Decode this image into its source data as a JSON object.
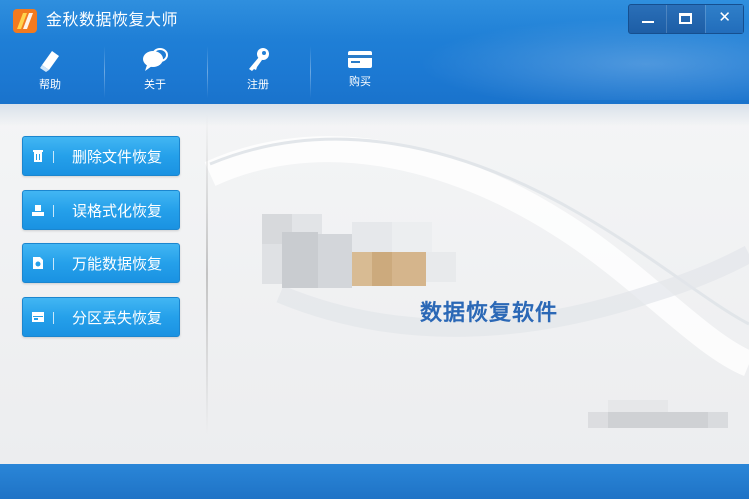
{
  "window": {
    "title": "金秋数据恢复大师",
    "controls": {
      "minimize": "–",
      "maximize": "□",
      "close": "✕"
    }
  },
  "toolbar": {
    "items": [
      {
        "label": "帮助",
        "icon": "eraser-icon"
      },
      {
        "label": "关于",
        "icon": "chat-bubble-icon"
      },
      {
        "label": "注册",
        "icon": "key-icon"
      },
      {
        "label": "购买",
        "icon": "credit-card-icon"
      }
    ]
  },
  "sidebar": {
    "items": [
      {
        "label": "删除文件恢复",
        "icon": "trash-icon"
      },
      {
        "label": "误格式化恢复",
        "icon": "drive-icon"
      },
      {
        "label": "万能数据恢复",
        "icon": "file-icon"
      },
      {
        "label": "分区丢失恢复",
        "icon": "partition-icon"
      }
    ]
  },
  "main": {
    "brand_text": "数据恢复软件"
  },
  "colors": {
    "header": "#1f7fd6",
    "sidebar_button": "#25a0ea",
    "brand_text": "#2b68b6",
    "footer": "#1f73c6"
  }
}
